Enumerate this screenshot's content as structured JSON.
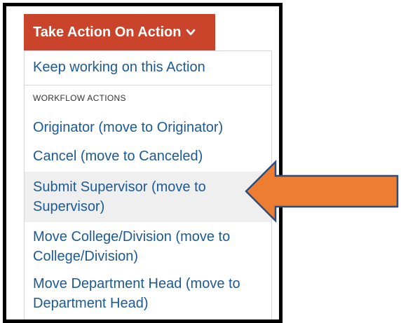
{
  "button": {
    "label": "Take Action On Action"
  },
  "menu": {
    "keep_working": "Keep working on this Action",
    "section_header": "WORKFLOW ACTIONS",
    "items": [
      {
        "label": "Originator (move to Originator)"
      },
      {
        "label": "Cancel (move to Canceled)"
      },
      {
        "label": "Submit Supervisor (move to Supervisor)",
        "highlighted": true
      },
      {
        "label": "Move College/Division (move to College/Division)"
      },
      {
        "label": "Move Department Head (move to Department Head)"
      }
    ]
  },
  "colors": {
    "button_bg": "#c9442a",
    "link": "#1b5a96",
    "highlight_bg": "#efefef",
    "arrow_fill": "#ed7d31",
    "arrow_stroke": "#2f4b7c"
  },
  "icons": {
    "dropdown": "chevron-down-icon",
    "callout": "arrow-left-icon"
  }
}
